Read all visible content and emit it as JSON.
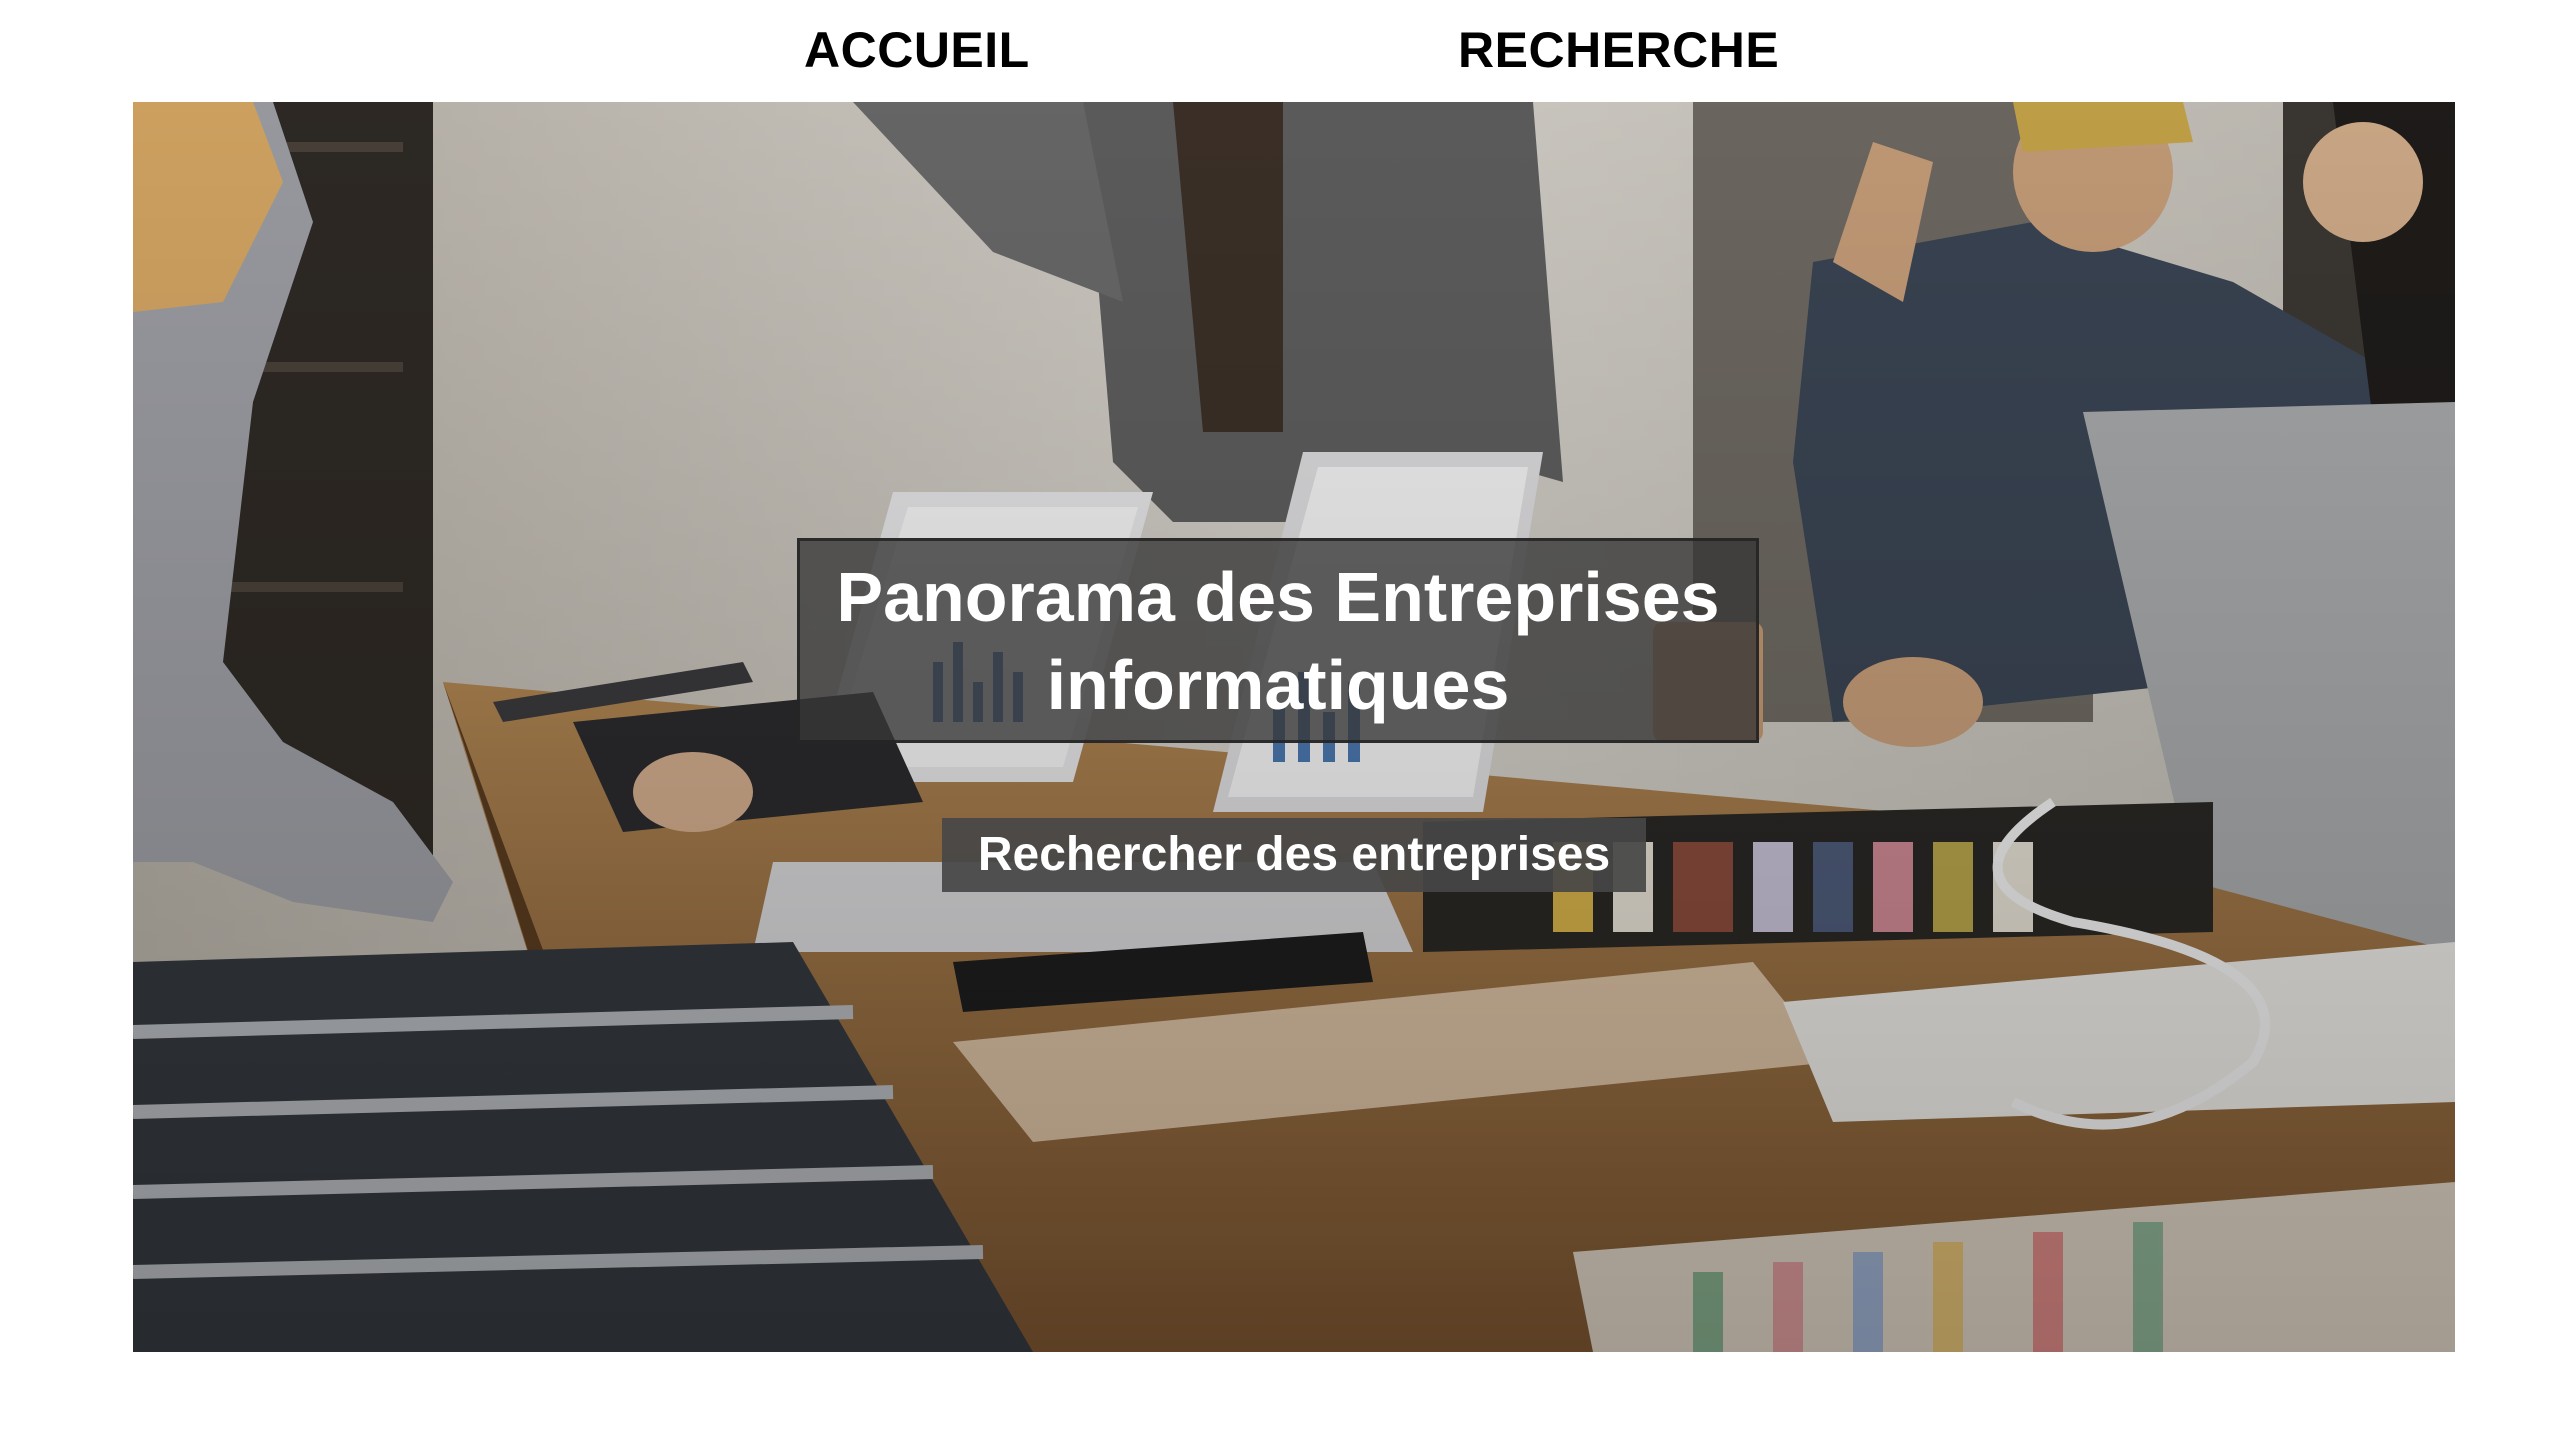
{
  "nav": {
    "home_label": "ACCUEIL",
    "search_label": "RECHERCHE"
  },
  "hero": {
    "title": "Panorama des Entreprises informatiques",
    "cta_label": "Rechercher des entreprises",
    "image": "office-meeting-photo"
  }
}
